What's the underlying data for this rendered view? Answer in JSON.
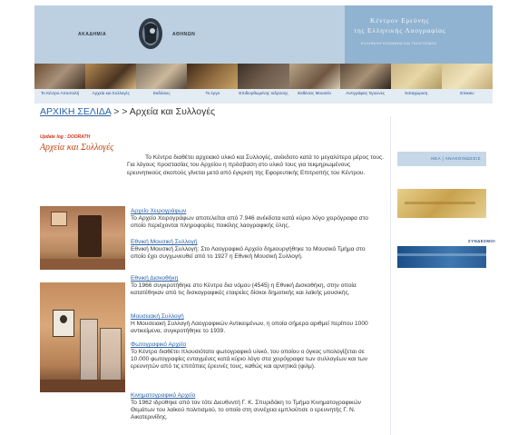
{
  "header": {
    "academy_word_left": "ΑΚΑΔΗΜΙΑ",
    "academy_word_right": "ΑΘΗΝΩΝ",
    "center_title_line1": "Κέντρον Ερεύνης",
    "center_title_line2": "της Ελληνικής Λαογραφίας",
    "center_subtitle": "ΕΛΛΗΝΙΚΗ ΚΟΙΝΩΝΙΑ ΚΑΙ ΠΟΛΙΤΙΣΜΟΣ"
  },
  "nav": {
    "items": [
      "Το Κέντρο Αποστολή",
      "Αρχεία και Συλλογές",
      "Εκδόσεις",
      "Το έργο",
      "Επιδιορθωμένης Ιοδρύσης",
      "Εκθέσεις Μουσείο",
      "Αντιγράφεις Έρευνες",
      "Καταχώριση",
      "Επικοιν"
    ]
  },
  "breadcrumb": {
    "home": "ΑΡΧΙΚΗ ΣΕΛΙΔΑ",
    "separator": " > > ",
    "current": "Αρχεία και Συλλογές"
  },
  "main": {
    "update_line": "Update log : DOORATH",
    "section_title": "Αρχεία και Συλλογές",
    "intro": "Το Κέντρο διαθέτει αρχειακό υλικό και Συλλογές, ανέκδοτο κατά το μεγαλύτερο μέρος τους. Για λόγους προστασίας του Αρχείου η πρόσβαση στο υλικό τους για τεκμηριωμένους ερευνητικούς σκοπούς γίνεται μετά από έγκριση της Εφορευτικής Επιτροπής του Κέντρου.",
    "entries": [
      {
        "title": "Αρχείο Χειρογράφων",
        "text": "Το Αρχείο Χειρογράφων αποτελείται από 7.946 ανέκδοτα κατά κύριο λόγο χειρόγραφα στο οποίο περιέχονται πληροφορίες ποικίλης λαογραφικής ύλης."
      },
      {
        "title": "Εθνική Μουσική Συλλογή",
        "text": "Εθνική Μουσική Συλλογή: Στο Λαογραφικό Αρχείο δημιουργήθηκε το Μουσικό Τμήμα στο οποίο έχει συγχωνευθεί από το 1927 η Εθνική Μουσική Συλλογή."
      },
      {
        "title": "Εθνική Δισκοθήκη",
        "text": "Το 1966 συγκροτήθηκε στο Κέντρο δια νόμου (4545) η Εθνική Δισκοθήκη, στην οποία κατατέθηκαν από τις δισκογραφικές εταιρείες δίσκοι δημοτικής και λαϊκής μουσικής."
      },
      {
        "title": "Μουσειακή Συλλογή",
        "text": "Η Μουσειακή Συλλογή Λαογραφικών Αντικειμένων, η οποία σήμερα αριθμεί περίπου 1000 αντικείμενα, συγκροτήθηκε το 1939."
      },
      {
        "title": "Φωτογραφικό Αρχείο",
        "text": "Το Κέντρο διαθέτει πλουσιότατο φωτογραφικό υλικό, του οποίου ο όγκος υπολογίζεται σε 10.000 φωτογραφίες ενταγμένες κατά κύριο λόγο στα χειρόγραφα των συλλογέων και των ερευνητών από τις επιτόπιες έρευνές τους, καθώς και αρνητικά (φιλμ)."
      },
      {
        "title": "Κινηματογραφικό Αρχείο",
        "text": "Το 1962 ιδρύθηκε από τον τότε Διευθυντή Γ. Κ. Σπυριδάκη το Τμήμα Κινηματογραφικών Θεμάτων του λαϊκού πολιτισμού, το οποίο στη συνέχεια εμπλούτισε ο ερευνητής Γ. Ν. Αικατερινίδης."
      }
    ]
  },
  "sidebar": {
    "box1_label": "ΝΕΑ | ΑΝΑΚΟΙΝΩΣΕΙΣ",
    "links_label": "ΣΥΝΔΕΣΜΟΙ"
  }
}
